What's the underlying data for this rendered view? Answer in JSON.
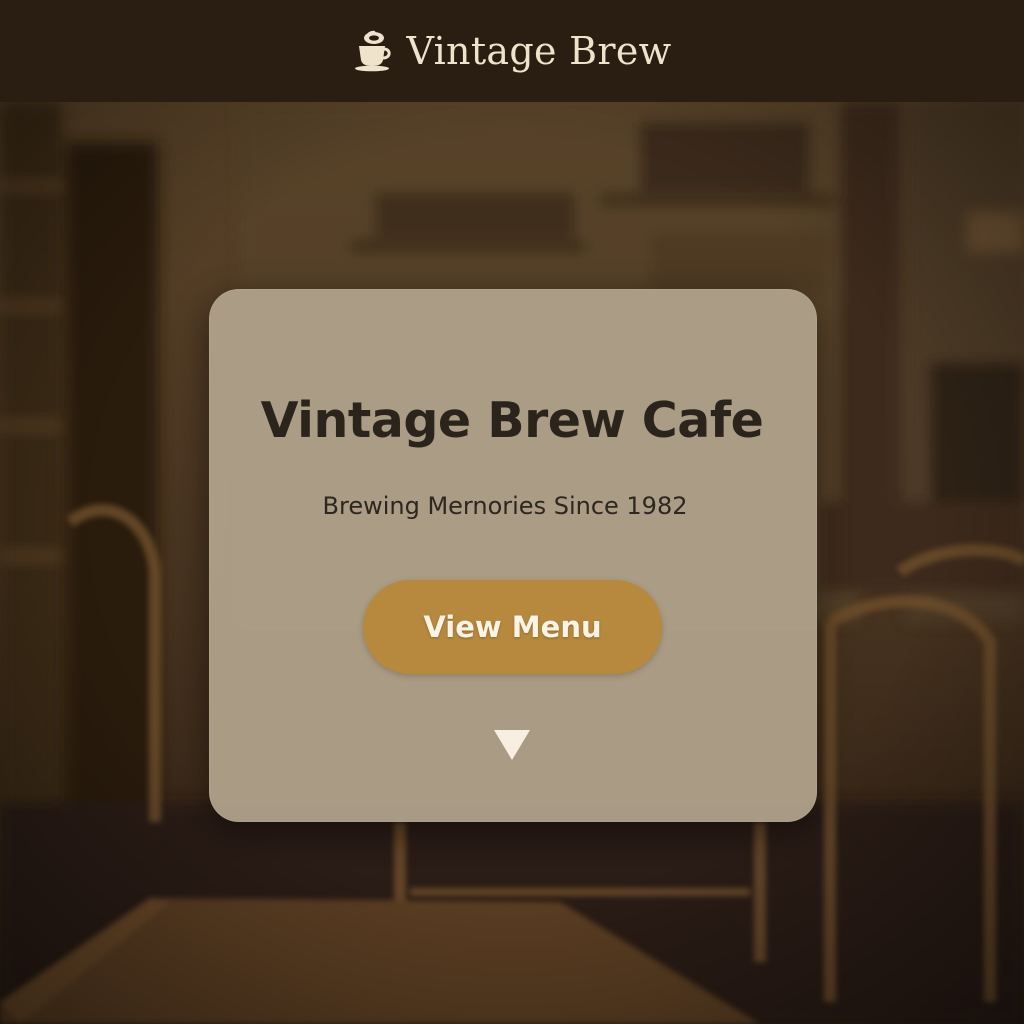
{
  "header": {
    "brand_icon": "coffee-cup-icon",
    "brand_name": "Vintage Brew"
  },
  "hero": {
    "title": "Vintage Brew Cafe",
    "tagline": "Brewing Mernories Since 1982",
    "cta_label": "View Menu",
    "scroll_icon": "down-triangle-icon"
  },
  "colors": {
    "header_bg": "#2a1e12",
    "brand_text": "#efe3cc",
    "card_bg": "#b0a38b",
    "title_text": "#2a241d",
    "button_bg": "#b6893e",
    "button_text": "#fbf4e6",
    "arrow": "#f6efe2"
  }
}
